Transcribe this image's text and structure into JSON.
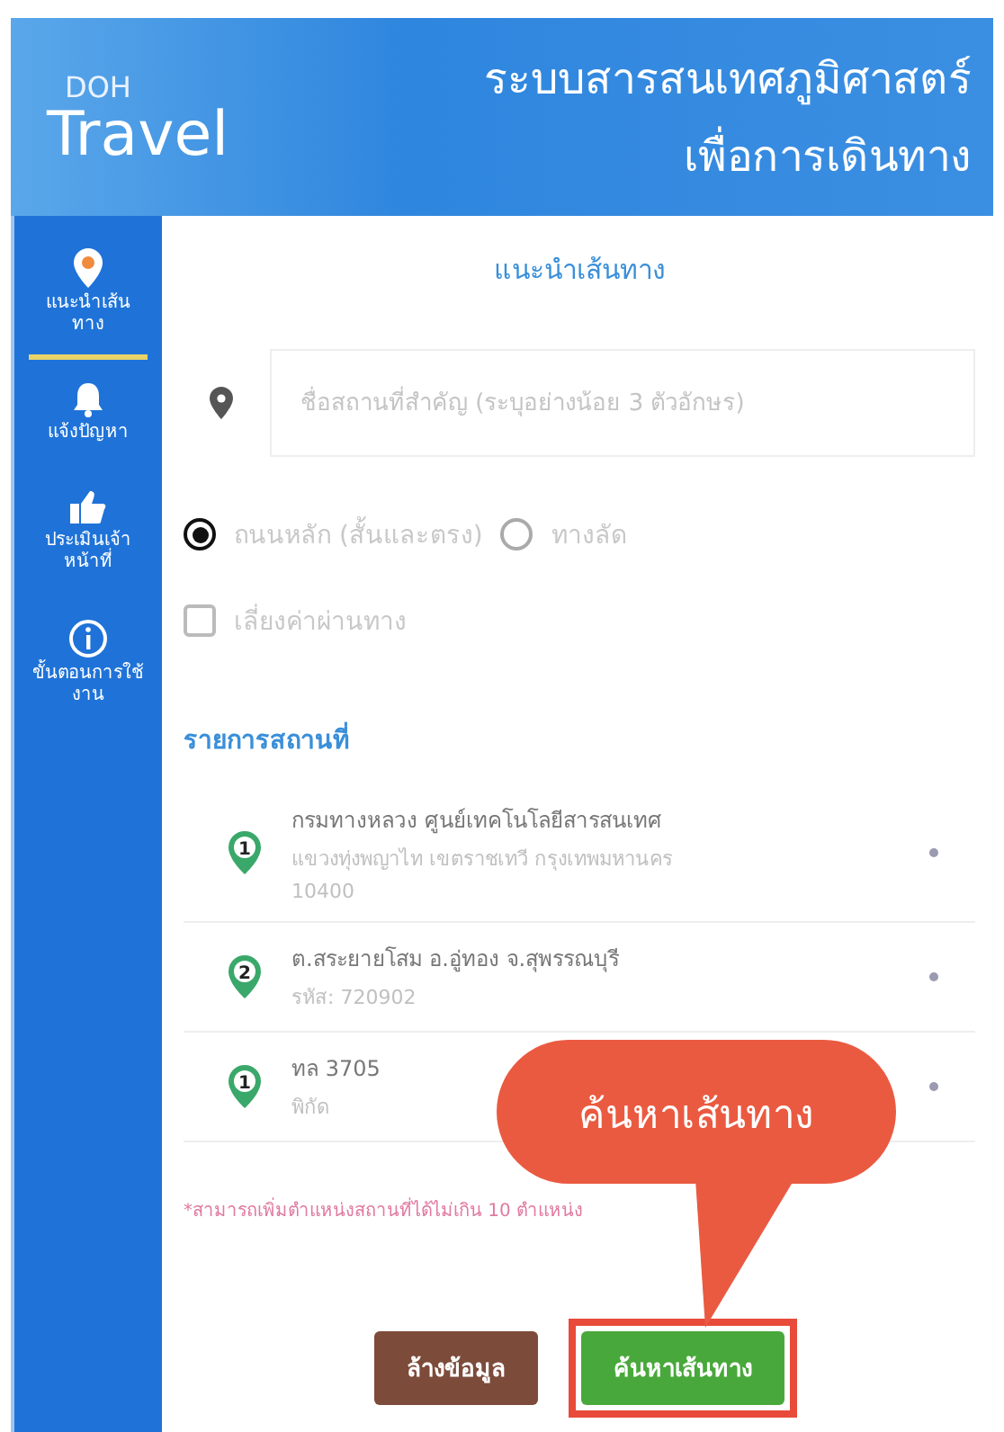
{
  "header": {
    "logo_top": "DOH",
    "logo_main": "Travel",
    "title_lines": [
      "ระบบสารสนเทศภูมิศาสตร์",
      "เพื่อการเดินทาง"
    ]
  },
  "sidebar": {
    "items": [
      {
        "kind": "pin",
        "label": "แนะนำเส้นทาง",
        "selected": true
      },
      {
        "kind": "bell",
        "label": "แจ้งปัญหา",
        "selected": false
      },
      {
        "kind": "thumb",
        "label": "ประเมินเจ้าหน้าที่",
        "selected": false
      },
      {
        "kind": "info",
        "label": "ขั้นตอนการใช้งาน",
        "selected": false
      }
    ]
  },
  "panel": {
    "heading": "แนะนำเส้นทาง",
    "search": {
      "placeholder": "ชื่อสถานที่สำคัญ (ระบุอย่างน้อย 3 ตัวอักษร)"
    },
    "route_options": [
      {
        "label": "ถนนหลัก (สั้นและตรง)",
        "selected": true
      },
      {
        "label": "ทางลัด",
        "selected": false
      }
    ],
    "avoid_toll": {
      "label": "เลี่ยงค่าผ่านทาง",
      "checked": false
    },
    "places_heading": "รายการสถานที่",
    "places": [
      {
        "marker": "1",
        "name": "กรมทางหลวง ศูนย์เทคโนโลยีสารสนเทศ",
        "details": [
          "แขวงทุ่งพญาไท เขตราชเทวี กรุงเทพมหานคร",
          "10400"
        ]
      },
      {
        "marker": "2",
        "name": "ต.สระยายโสม อ.อู่ทอง จ.สุพรรณบุรี",
        "details": [
          "รหัส: 720902"
        ]
      },
      {
        "marker": "1",
        "name": "ทล 3705",
        "details": [
          "พิกัด"
        ]
      }
    ],
    "note": "*สามารถเพิ่มตำแหน่งสถานที่ได้ไม่เกิน 10 ตำแหน่ง",
    "buttons": [
      {
        "kind": "clear",
        "label": "ล้างข้อมูล",
        "highlighted": false
      },
      {
        "kind": "search",
        "label": "ค้นหาเส้นทาง",
        "highlighted": true
      }
    ]
  },
  "callout": {
    "text": "ค้นหาเส้นทาง"
  }
}
